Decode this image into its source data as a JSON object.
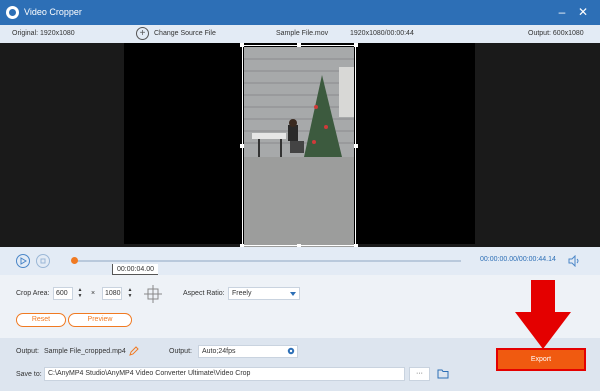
{
  "window": {
    "title": "Video Cropper",
    "icons": [
      "app-logo-icon",
      "minimize-icon",
      "close-icon"
    ]
  },
  "info": {
    "original": "Original: 1920x1080",
    "change_source": "Change Source File",
    "file_name": "Sample File.mov",
    "file_meta": "1920x1080/00:00:44",
    "output": "Output: 600x1080"
  },
  "playback": {
    "time": "00:00:00.00/00:00:44.14",
    "marker_time": "00:00:04.00",
    "progress": 0.0,
    "icons": [
      "play-icon",
      "stop-icon",
      "volume-icon"
    ]
  },
  "crop": {
    "label": "Crop Area:",
    "width": "600",
    "times": "×",
    "height": "1080",
    "aspect_label": "Aspect Ratio:",
    "aspect_value": "Freely",
    "reset": "Reset",
    "preview": "Preview"
  },
  "output": {
    "label": "Output:",
    "file": "Sample File_cropped.mp4",
    "format_label": "Output:",
    "format": "Auto;24fps",
    "save_label": "Save to:",
    "path": "C:\\AnyMP4 Studio\\AnyMP4 Video Converter Ultimate\\Video Crop",
    "browse": "···",
    "export": "Export"
  },
  "colors": {
    "accent": "#2d6fb6",
    "export": "#f05a10",
    "arrow": "#e40000"
  }
}
